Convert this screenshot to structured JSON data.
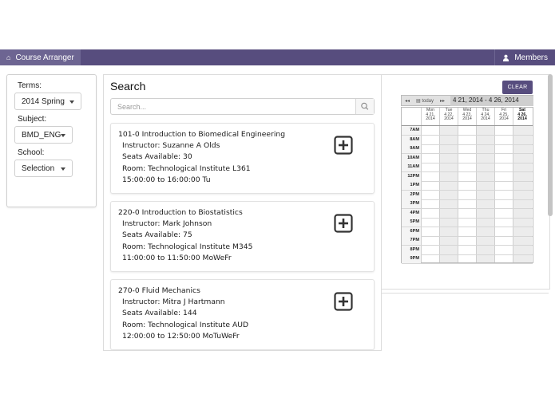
{
  "nav": {
    "brand": "Course Arranger",
    "members": "Members",
    "colors": {
      "bar": "#574d7e",
      "brand_bg": "#6d6592"
    }
  },
  "filters": {
    "terms_label": "Terms:",
    "terms_value": "2014 Spring",
    "subject_label": "Subject:",
    "subject_value": "BMD_ENG",
    "school_label": "School:",
    "school_value": "Selection"
  },
  "search": {
    "title": "Search",
    "placeholder": "Search...",
    "icon": "search-icon"
  },
  "courses": [
    {
      "title": "101-0 Introduction to Biomedical Engineering",
      "instructor": "Instructor: Suzanne A Olds",
      "seats": "Seats Available: 30",
      "room": "Room: Technological Institute L361",
      "time": "15:00:00 to 16:00:00 Tu"
    },
    {
      "title": "220-0 Introduction to Biostatistics",
      "instructor": "Instructor: Mark Johnson",
      "seats": "Seats Available: 75",
      "room": "Room: Technological Institute M345",
      "time": "11:00:00 to 11:50:00 MoWeFr"
    },
    {
      "title": "270-0 Fluid Mechanics",
      "instructor": "Instructor: Mitra J Hartmann",
      "seats": "Seats Available: 144",
      "room": "Room: Technological Institute AUD",
      "time": "12:00:00 to 12:50:00 MoTuWeFr"
    }
  ],
  "calendar": {
    "clear_label": "CLEAR",
    "prev": "◂◂",
    "today": "today",
    "next": "▸▸",
    "range": "4 21, 2014 - 4 26, 2014",
    "days": [
      {
        "name": "Mon",
        "date": "4 21,",
        "year": "2014"
      },
      {
        "name": "Tue",
        "date": "4 22,",
        "year": "2014"
      },
      {
        "name": "Wed",
        "date": "4 23,",
        "year": "2014"
      },
      {
        "name": "Thu",
        "date": "4 24,",
        "year": "2014"
      },
      {
        "name": "Fri",
        "date": "4 25,",
        "year": "2014"
      },
      {
        "name": "Sat",
        "date": "4 26,",
        "year": "2014"
      }
    ],
    "times": [
      "7AM",
      "8AM",
      "9AM",
      "10AM",
      "11AM",
      "12PM",
      "1PM",
      "2PM",
      "3PM",
      "4PM",
      "5PM",
      "6PM",
      "7PM",
      "8PM",
      "9PM"
    ]
  }
}
